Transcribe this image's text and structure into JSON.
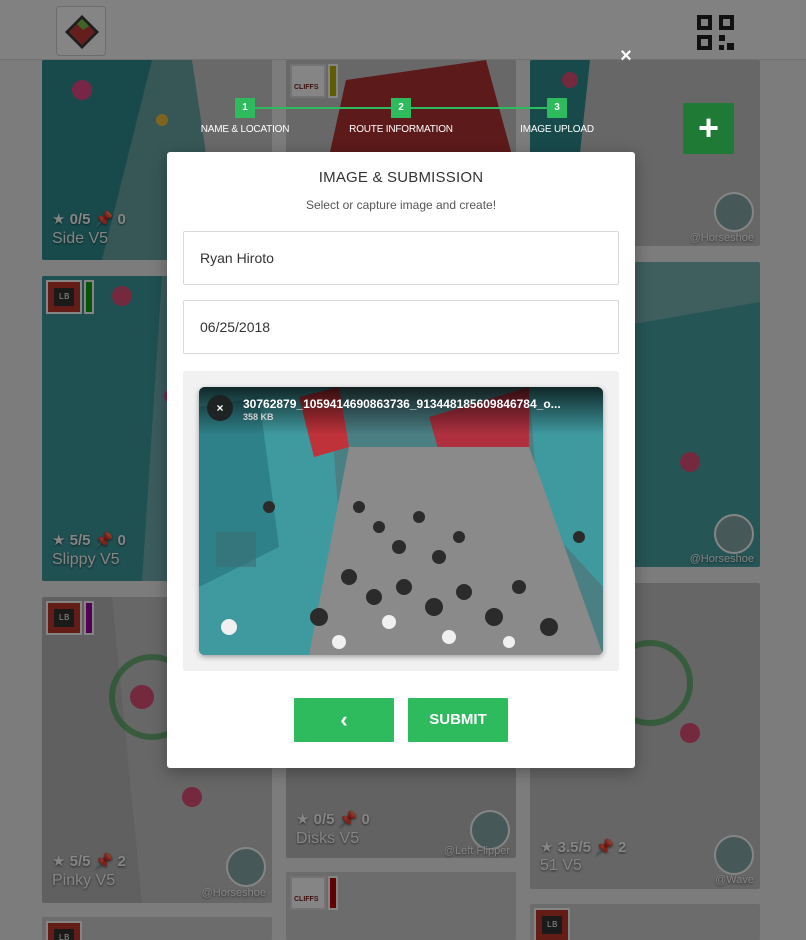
{
  "stepper": {
    "steps": [
      {
        "number": "1",
        "label": "NAME & LOCATION"
      },
      {
        "number": "2",
        "label": "ROUTE INFORMATION"
      },
      {
        "number": "3",
        "label": "IMAGE UPLOAD"
      }
    ],
    "active_step": 3,
    "close_symbol": "×"
  },
  "fab": {
    "label": "+"
  },
  "modal": {
    "title": "IMAGE & SUBMISSION",
    "subtitle": "Select or capture image and create!",
    "setter_name": "Ryan Hiroto",
    "date": "06/25/2018",
    "upload": {
      "file_name": "30762879_1059414690863736_913448185609846784_o...",
      "file_size": "358 KB",
      "remove_symbol": "×"
    },
    "back_button": "‹",
    "submit_button": "SUBMIT"
  },
  "cards": [
    {
      "rating": "0/5",
      "sends": "0",
      "name": "Side V5",
      "author": "",
      "color": "#2ea043"
    },
    {
      "rating": "",
      "sends": "",
      "name": "",
      "author": "",
      "color": "#b9b000"
    },
    {
      "rating": "",
      "sends": "",
      "name": "",
      "author": "@Horseshoe",
      "color": ""
    },
    {
      "rating": "5/5",
      "sends": "0",
      "name": "Slippy V5",
      "author": "",
      "color": "#10a010"
    },
    {
      "rating": "",
      "sends": "",
      "name": "",
      "author": "@Horseshoe",
      "color": ""
    },
    {
      "rating": "5/5",
      "sends": "2",
      "name": "Pinky V5",
      "author": "@Horseshoe",
      "color": "#9b00a0"
    },
    {
      "rating": "0/5",
      "sends": "0",
      "name": "Disks V5",
      "author": "@Left Flipper",
      "color": ""
    },
    {
      "rating": "3.5/5",
      "sends": "2",
      "name": "51 V5",
      "author": "@Wave",
      "color": ""
    },
    {
      "rating": "",
      "sends": "",
      "name": "",
      "author": "",
      "color": "#c00000"
    }
  ],
  "icons": {
    "logo": "mountain-logo-icon",
    "qr": "qr-code-icon",
    "star": "star-icon",
    "pin": "pin-icon",
    "avatar": "avatar"
  },
  "colors": {
    "accent": "#2dbb5d",
    "fab": "#1e7a34",
    "overlay": "rgba(0,0,0,0.48)"
  }
}
